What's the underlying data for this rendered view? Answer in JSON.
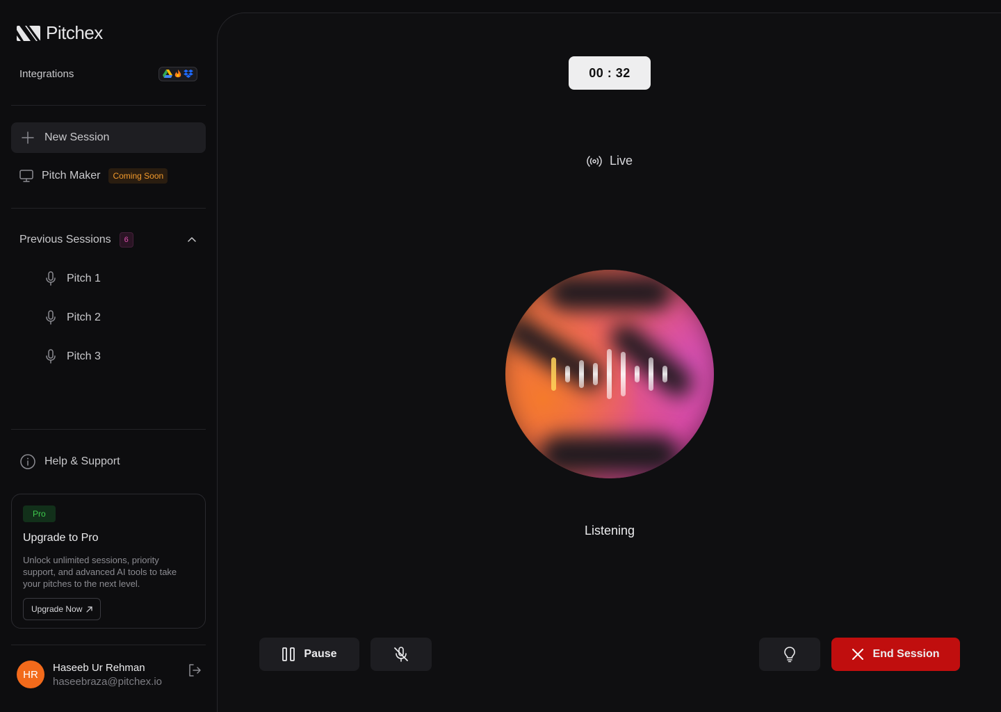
{
  "brand": {
    "name": "Pitchex"
  },
  "sidebar": {
    "integrations_label": "Integrations",
    "new_session_label": "New Session",
    "pitch_maker_label": "Pitch Maker",
    "coming_soon_label": "Coming Soon",
    "previous_sessions_label": "Previous Sessions",
    "previous_sessions_count": "6",
    "sessions": [
      {
        "label": "Pitch 1"
      },
      {
        "label": "Pitch 2"
      },
      {
        "label": "Pitch 3"
      }
    ],
    "help_label": "Help & Support"
  },
  "pro_card": {
    "badge": "Pro",
    "title": "Upgrade to Pro",
    "description": "Unlock unlimited sessions, priority support, and advanced AI tools to take your pitches to the next level.",
    "button_label": "Upgrade Now"
  },
  "user": {
    "initials": "HR",
    "name": "Haseeb Ur Rehman",
    "email": "haseebraza@pitchex.io"
  },
  "session": {
    "timer": "00 : 32",
    "live_label": "Live",
    "status": "Listening"
  },
  "controls": {
    "pause_label": "Pause",
    "end_label": "End Session"
  },
  "colors": {
    "accent_orange": "#f26a1b",
    "end_red": "#c00e0e",
    "coming_soon": "#f39a2c",
    "pro_green": "#3fcb4d",
    "count_pink": "#e051b0"
  },
  "icons": [
    "logo-icon",
    "google-drive-icon",
    "firebase-icon",
    "dropbox-icon",
    "plus-icon",
    "monitor-icon",
    "chevron-up-icon",
    "mic-icon",
    "info-icon",
    "external-arrow-icon",
    "logout-icon",
    "broadcast-icon",
    "pause-icon",
    "mic-off-icon",
    "lightbulb-icon",
    "close-icon"
  ]
}
